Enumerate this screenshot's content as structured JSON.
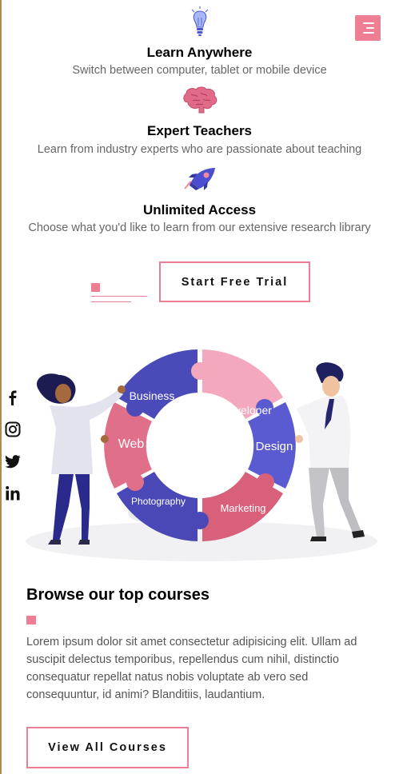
{
  "header": {
    "menu_icon": "hamburger-menu-icon",
    "accent_color": "#ee7e93"
  },
  "features": [
    {
      "icon": "lightbulb-icon",
      "title": "Learn Anywhere",
      "text": "Switch between computer, tablet or mobile device"
    },
    {
      "icon": "brain-icon",
      "title": "Expert Teachers",
      "text": "Learn from industry experts who are passionate about teaching"
    },
    {
      "icon": "rocket-icon",
      "title": "Unlimited Access",
      "text": "Choose what you'd like to learn from our extensive research library"
    }
  ],
  "cta": {
    "trial_label": "Start Free Trial"
  },
  "social": [
    "facebook-icon",
    "instagram-icon",
    "twitter-icon",
    "linkedin-icon"
  ],
  "illustration": {
    "pieces": [
      "Business",
      "Developer",
      "Design",
      "Marketing",
      "Photography",
      "Web"
    ]
  },
  "courses": {
    "title": "Browse our top courses",
    "description": "Lorem ipsum dolor sit amet consectetur adipisicing elit. Ullam ad suscipit delectus temporibus, repellendus cum nihil, distinctio consequatur repellat natus nobis voluptate ab vero sed consequuntur, id animi? Blanditiis, laudantium.",
    "button_label": "View All Courses"
  }
}
